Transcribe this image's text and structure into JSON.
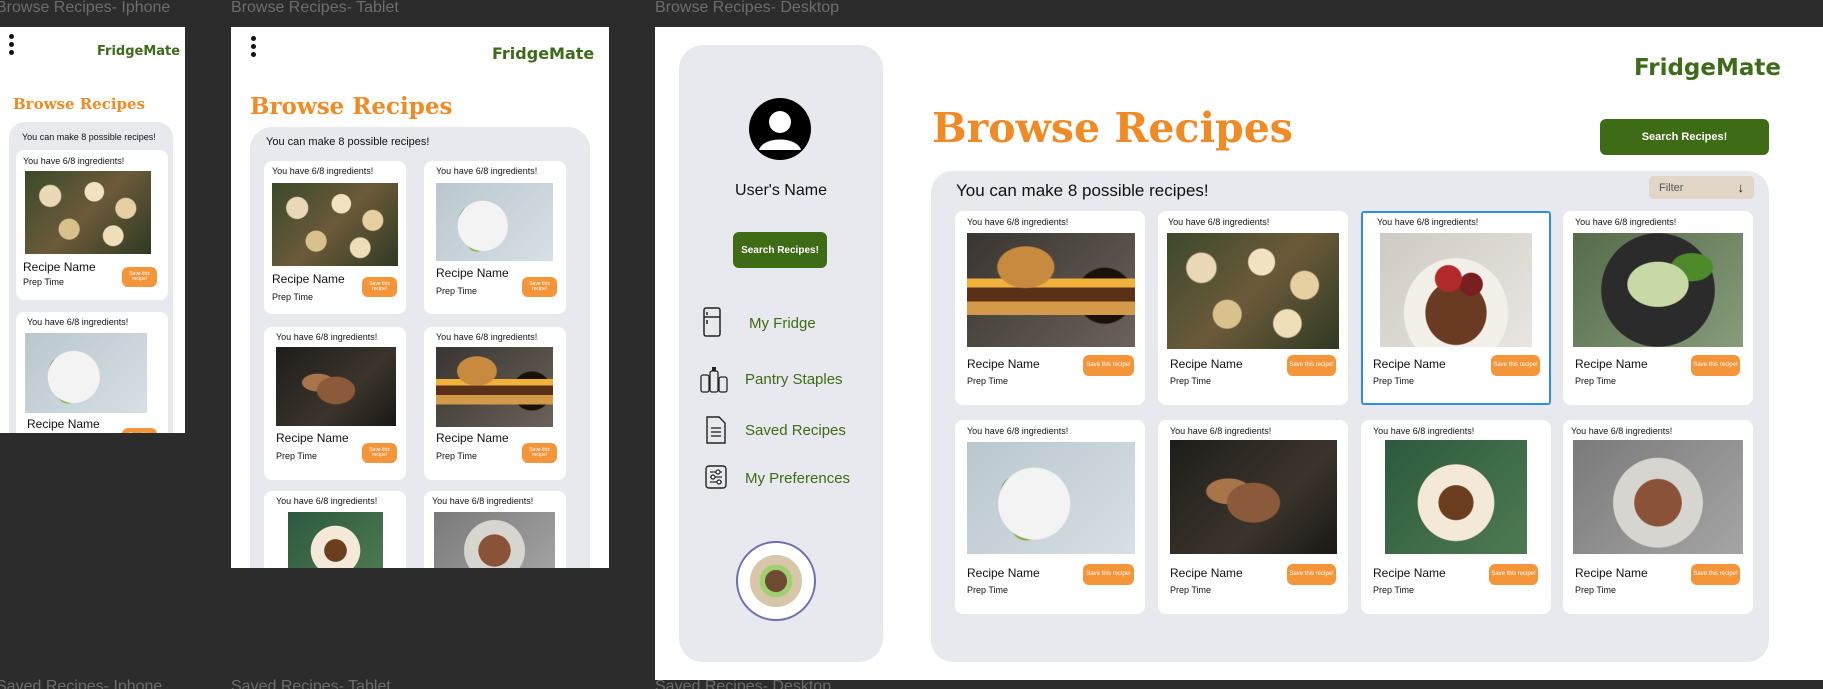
{
  "frames": {
    "iphone": "Browse Recipes- Iphone",
    "tablet": "Browse Recipes- Tablet",
    "desktop": "Browse Recipes- Desktop",
    "saved_iphone": "Saved Recipes- Iphone",
    "saved_tablet": "Saved Recipes- Tablet",
    "saved_desktop": "Saved Recipes- Desktop"
  },
  "app": {
    "brand": "FridgeMate",
    "title": "Browse Recipes",
    "possible": "You can make 8 possible recipes!",
    "search_button": "Search Recipes!",
    "filter_label": "Filter",
    "user_name": "User's Name"
  },
  "card": {
    "have": "You have 6/8 ingredients!",
    "recipe_name": "Recipe Name",
    "prep_time": "Prep Time",
    "save_label": "Save this recipe!"
  },
  "sidebar": {
    "items": [
      {
        "label": "My Fridge",
        "icon": "fridge-icon"
      },
      {
        "label": "Pantry Staples",
        "icon": "pantry-icon"
      },
      {
        "label": "Saved Recipes",
        "icon": "document-icon"
      },
      {
        "label": "My Preferences",
        "icon": "sliders-icon"
      }
    ]
  },
  "colors": {
    "brand_green": "#3e6b16",
    "accent_orange": "#f08a24",
    "panel_gray": "#e8e9ee",
    "canvas": "#2c2c2c"
  }
}
